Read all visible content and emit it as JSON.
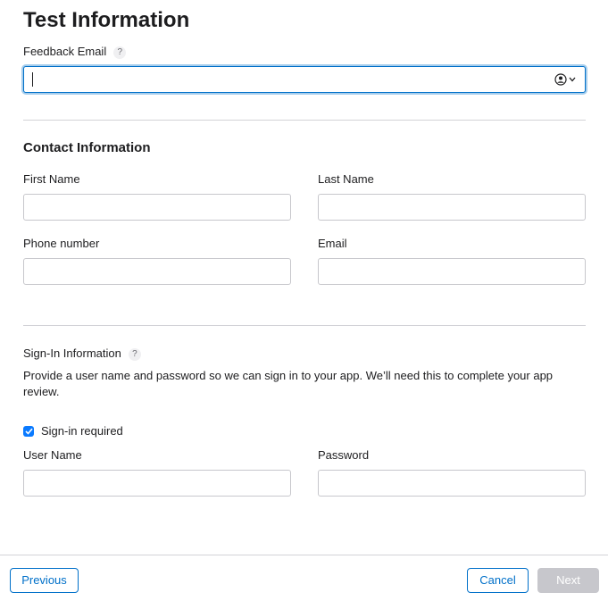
{
  "page": {
    "title": "Test Information"
  },
  "feedback": {
    "label": "Feedback Email",
    "help": "?",
    "value": ""
  },
  "contact": {
    "heading": "Contact Information",
    "first_name_label": "First Name",
    "last_name_label": "Last Name",
    "phone_label": "Phone number",
    "email_label": "Email"
  },
  "signin": {
    "heading": "Sign-In Information",
    "help": "?",
    "description_line1": "Provide a user name and password so we can sign in to your app. We’ll need this to complete your app",
    "description_line2": "review.",
    "required_label": "Sign-in required",
    "required_checked": true,
    "username_label": "User Name",
    "password_label": "Password"
  },
  "footer": {
    "previous_label": "Previous",
    "cancel_label": "Cancel",
    "next_label": "Next"
  },
  "colors": {
    "accent": "#0070c9",
    "checkbox": "#0a7aff",
    "disabled": "#c7c7cc",
    "divider": "#d2d2d7"
  },
  "icons": {
    "help": "question-mark-icon",
    "contact_picker": "person-circle-icon",
    "dropdown": "chevron-down-icon",
    "checkbox": "checkmark-icon"
  }
}
